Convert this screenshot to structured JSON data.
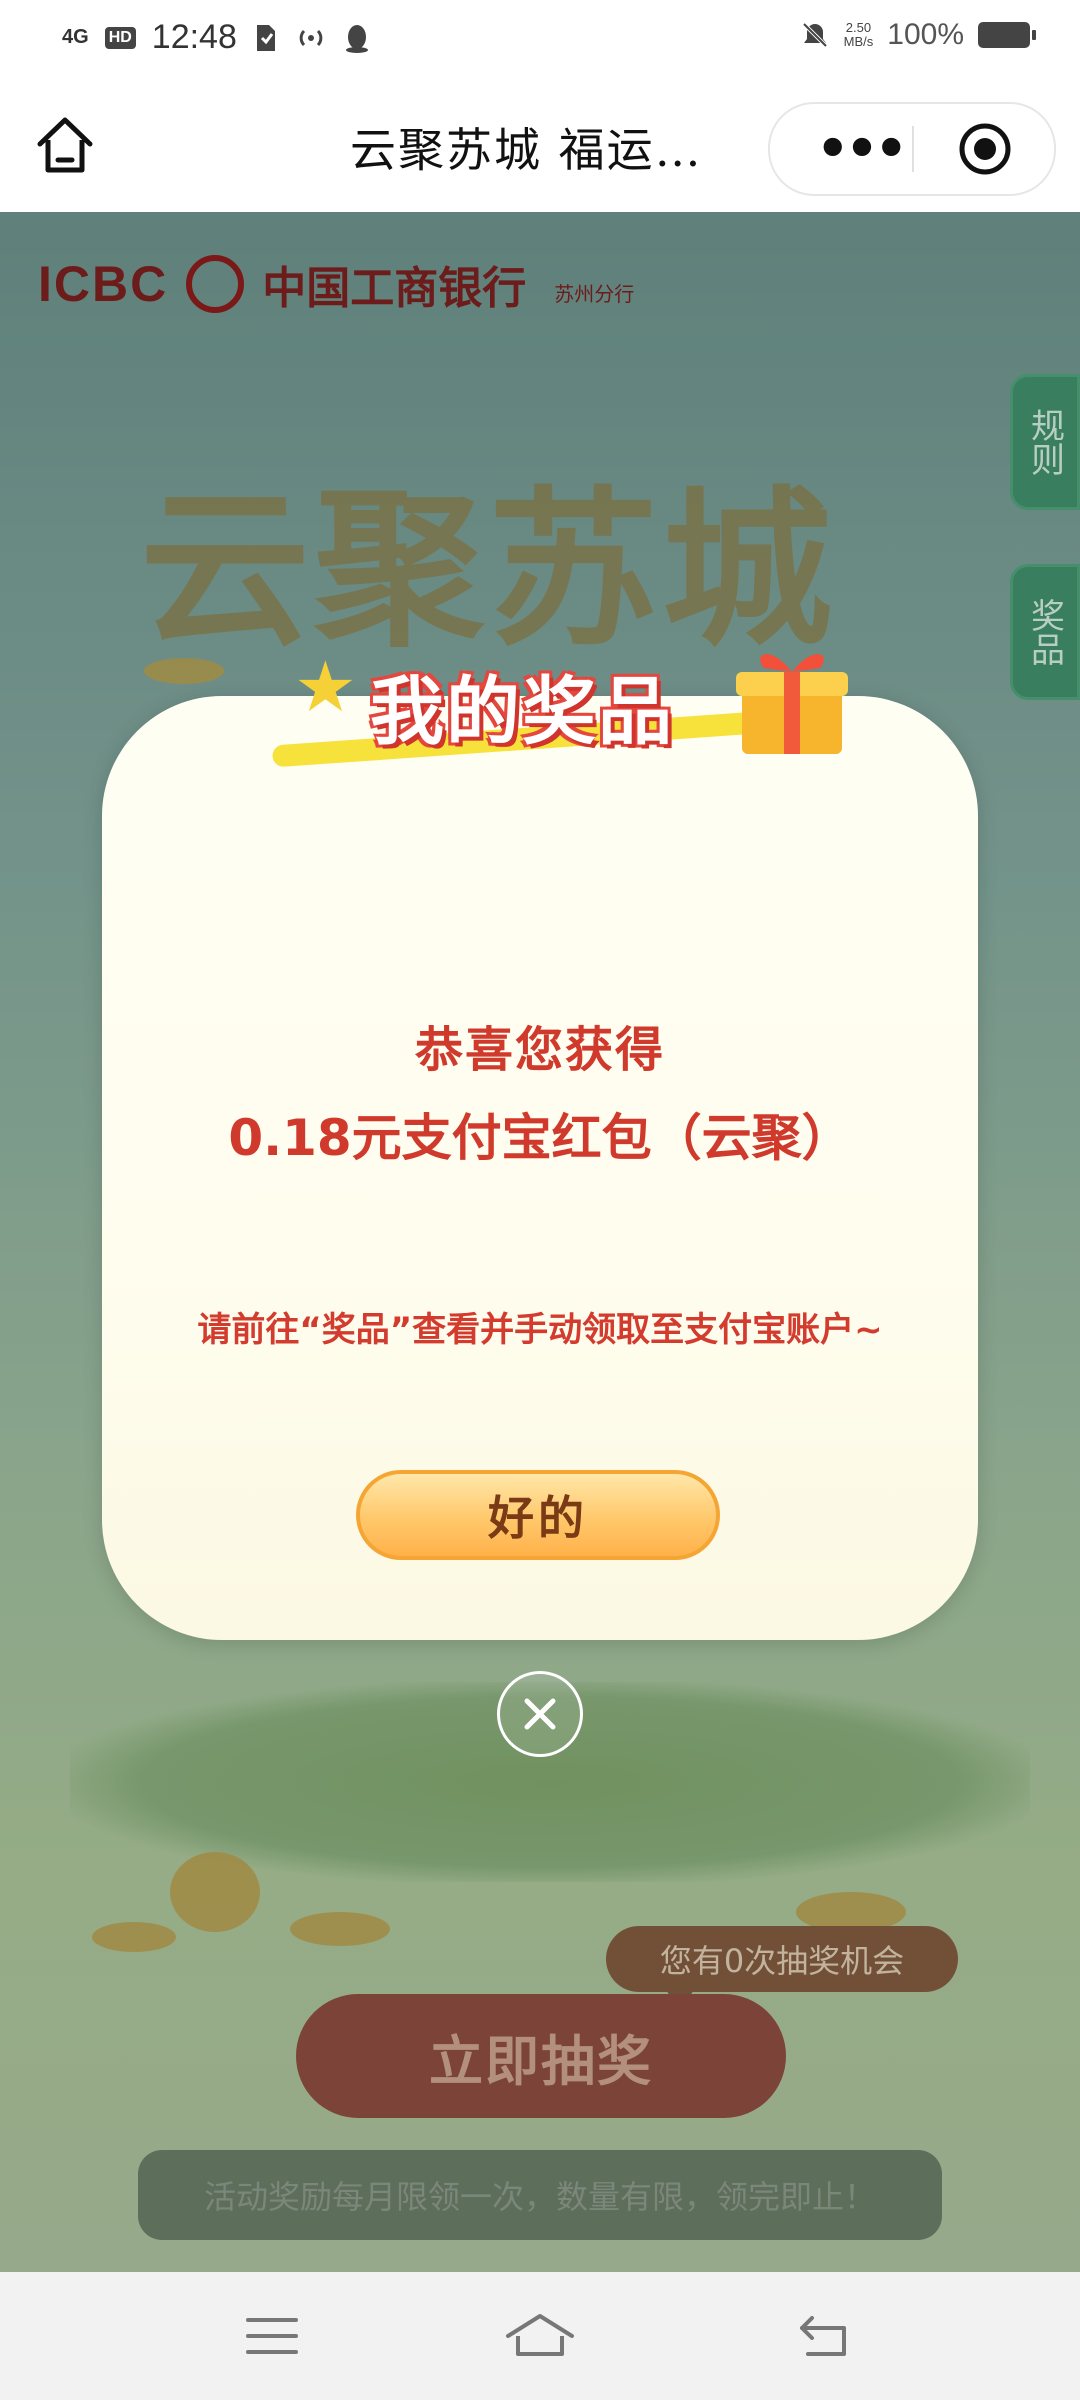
{
  "status_bar": {
    "network": "4G",
    "hd": "HD",
    "time": "12:48",
    "speed_value": "2.50",
    "speed_unit": "MB/s",
    "battery": "100%"
  },
  "nav_bar": {
    "title": "云聚苏城 福运…",
    "more_label": "•••"
  },
  "background": {
    "bank_abbr": "ICBC",
    "bank_name": "中国工商银行",
    "branch": "苏州分行",
    "hero_title": "云聚苏城",
    "side_tabs": [
      "规则",
      "奖品"
    ],
    "chance_badge": "您有0次抽奖机会",
    "draw_button": "立即抽奖",
    "notice": "活动奖励每月限领一次，数量有限，领完即止！"
  },
  "modal": {
    "title": "我的奖品",
    "congrats": "恭喜您获得",
    "prize": "0.18元支付宝红包（云聚）",
    "hint": "请前往“奖品”查看并手动领取至支付宝账户~",
    "ok_button": "好的"
  },
  "colors": {
    "accent_red": "#d03a2c",
    "button_orange": "#ffc86b",
    "side_tab_green": "#3f8d6a"
  },
  "icons": [
    "home-icon",
    "more-icon",
    "target-icon",
    "close-icon",
    "menu-icon",
    "home-nav-icon",
    "back-icon"
  ]
}
